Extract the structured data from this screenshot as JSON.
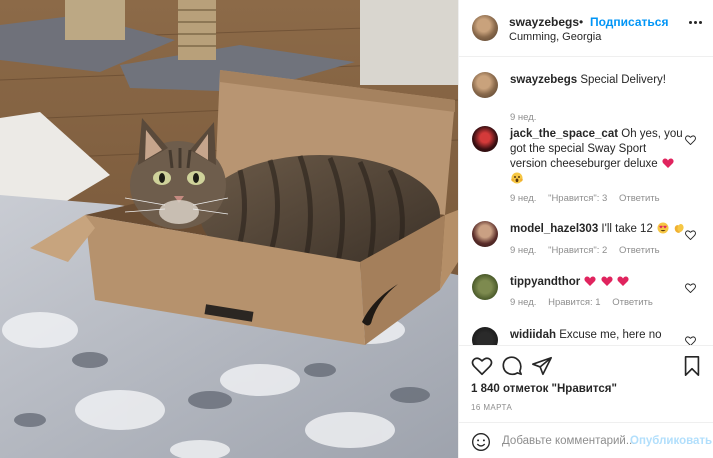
{
  "post": {
    "photo_alt": "",
    "header": {
      "username": "swayzebegs",
      "separator": "•",
      "follow_label": "Подписаться",
      "location": "Cumming, Georgia",
      "more_icon": "more-horizontal-icon"
    },
    "caption": {
      "username": "swayzebegs",
      "text": "Special Delivery!",
      "time": "9 нед."
    },
    "comments": [
      {
        "username": "jack_the_space_cat",
        "text": "Oh yes, you got the special Sway Sport version cheeseburger deluxe",
        "emojis": [
          "heart-emoji",
          "scream-emoji"
        ],
        "time": "9 нед.",
        "likes": "\"Нравится\": 3",
        "reply": "Ответить"
      },
      {
        "username": "model_hazel303",
        "text": "I'll take 12",
        "emojis": [
          "heart-eyes-emoji",
          "clap-emoji"
        ],
        "time": "9 нед.",
        "likes": "\"Нравится\": 2",
        "reply": "Ответить"
      },
      {
        "username": "tippyandthor",
        "text": "",
        "emojis": [
          "heart-emoji",
          "heart-emoji",
          "heart-emoji"
        ],
        "time": "9 нед.",
        "likes": "Нравится: 1",
        "reply": "Ответить"
      },
      {
        "username": "widiidah",
        "text": "Excuse me, here no",
        "emojis": [],
        "time": "",
        "likes": "",
        "reply": ""
      }
    ],
    "actions": {
      "icons": [
        "like-heart-icon",
        "comment-icon",
        "share-icon",
        "save-bookmark-icon"
      ],
      "likes_count": "1 840 отметок \"Нравится\"",
      "date": "16 МАРТА"
    },
    "add_comment": {
      "placeholder": "Добавьте комментарий...",
      "publish_label": "Опубликовать",
      "emoji_icon": "smiley-face-icon"
    }
  },
  "colors": {
    "accent": "#0095f6",
    "publish_disabled": "#b2dffc",
    "secondary_text": "#8e8e8e",
    "heart_emoji": "#e0245e"
  }
}
